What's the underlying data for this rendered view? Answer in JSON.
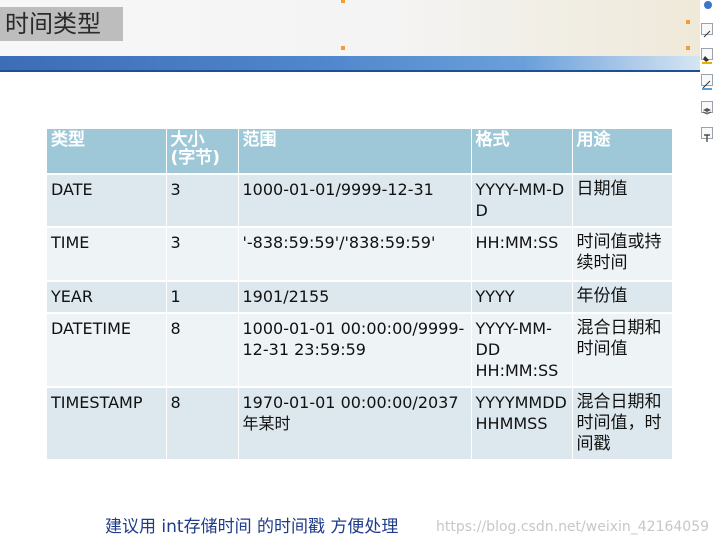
{
  "slide": {
    "title": "时间类型",
    "accent_color": "#3c6db7",
    "header_fill": "#9ec8d8"
  },
  "table": {
    "headers": [
      "类型",
      "大小\n(字节)",
      "范围",
      "格式",
      "用途"
    ],
    "rows": [
      {
        "type": "DATE",
        "size": "3",
        "range": "1000-01-01/9999-12-31",
        "format": "YYYY-MM-DD",
        "use": "日期值"
      },
      {
        "type": "TIME",
        "size": "3",
        "range": "'-838:59:59'/'838:59:59'",
        "format": "HH:MM:SS",
        "use": "时间值或持续时间"
      },
      {
        "type": "YEAR",
        "size": "1",
        "range": "1901/2155",
        "format": "YYYY",
        "use": "年份值"
      },
      {
        "type": "DATETIME",
        "size": "8",
        "range": "1000-01-01 00:00:00/9999-12-31 23:59:59",
        "format": "YYYY-MM-DD HH:MM:SS",
        "use": "混合日期和时间值"
      },
      {
        "type": "TIMESTAMP",
        "size": "8",
        "range": "1970-01-01 00:00:00/2037 年某时",
        "format": "YYYYMMDD HHMMSS",
        "use": "混合日期和时间值，时间戳"
      }
    ]
  },
  "note": "建议用 int存储时间 的时间戳 方便处理",
  "watermark": "https://blog.csdn.net/weixin_42164059",
  "toolbar_icons": [
    "circle-icon",
    "edit-icon",
    "fill-icon",
    "draw-icon",
    "layers-icon",
    "text-icon"
  ]
}
